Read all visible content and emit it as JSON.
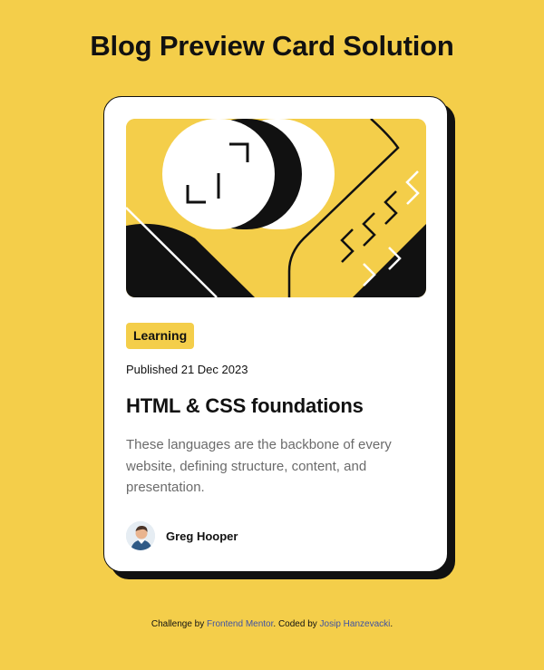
{
  "page": {
    "heading": "Blog Preview Card Solution"
  },
  "card": {
    "illustration_name": "illustration-article",
    "tag": "Learning",
    "published": "Published 21 Dec 2023",
    "title": "HTML & CSS foundations",
    "description": "These languages are the backbone of every website, defining structure, content, and presentation.",
    "author": {
      "name": "Greg Hooper",
      "avatar_icon": "avatar-image"
    }
  },
  "attribution": {
    "prefix": "Challenge by ",
    "challenge_link": "Frontend Mentor",
    "middle": ". Coded by ",
    "coder_link": "Josip Hanzevacki",
    "suffix": "."
  },
  "colors": {
    "background": "#F4CE4A",
    "card": "#FFFFFF",
    "ink": "#111111",
    "muted_text": "#6B6B6B",
    "link": "#3E52A3"
  }
}
